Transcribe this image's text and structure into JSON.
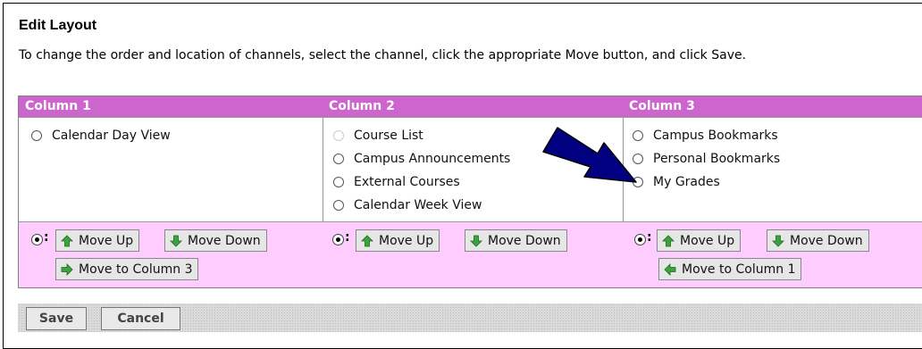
{
  "page": {
    "title": "Edit Layout",
    "instructions": "To change the order and location of channels, select the channel, click the appropriate Move button, and click Save."
  },
  "columns": [
    {
      "header": "Column 1",
      "channels": [
        {
          "label": "Calendar Day View",
          "enabled": true
        }
      ],
      "buttons": {
        "up": "Move Up",
        "down": "Move Down",
        "move_to": "Move to Column 3"
      }
    },
    {
      "header": "Column 2",
      "channels": [
        {
          "label": "Course List",
          "enabled": false
        },
        {
          "label": "Campus Announcements",
          "enabled": true
        },
        {
          "label": "External Courses",
          "enabled": true
        },
        {
          "label": "Calendar Week View",
          "enabled": true
        }
      ],
      "buttons": {
        "up": "Move Up",
        "down": "Move Down"
      }
    },
    {
      "header": "Column 3",
      "channels": [
        {
          "label": "Campus Bookmarks",
          "enabled": true
        },
        {
          "label": "Personal Bookmarks",
          "enabled": true
        },
        {
          "label": "My Grades",
          "enabled": true
        }
      ],
      "buttons": {
        "up": "Move Up",
        "down": "Move Down",
        "move_to": "Move to Column 1"
      }
    }
  ],
  "footer": {
    "save": "Save",
    "cancel": "Cancel"
  },
  "colors": {
    "header": "#cc66cc",
    "controls": "#ffccff",
    "annotation_arrow": "#000080"
  },
  "icons": {
    "up": "green-up-arrow-icon",
    "down": "green-down-arrow-icon",
    "right": "green-right-arrow-icon",
    "left": "green-left-arrow-icon"
  }
}
